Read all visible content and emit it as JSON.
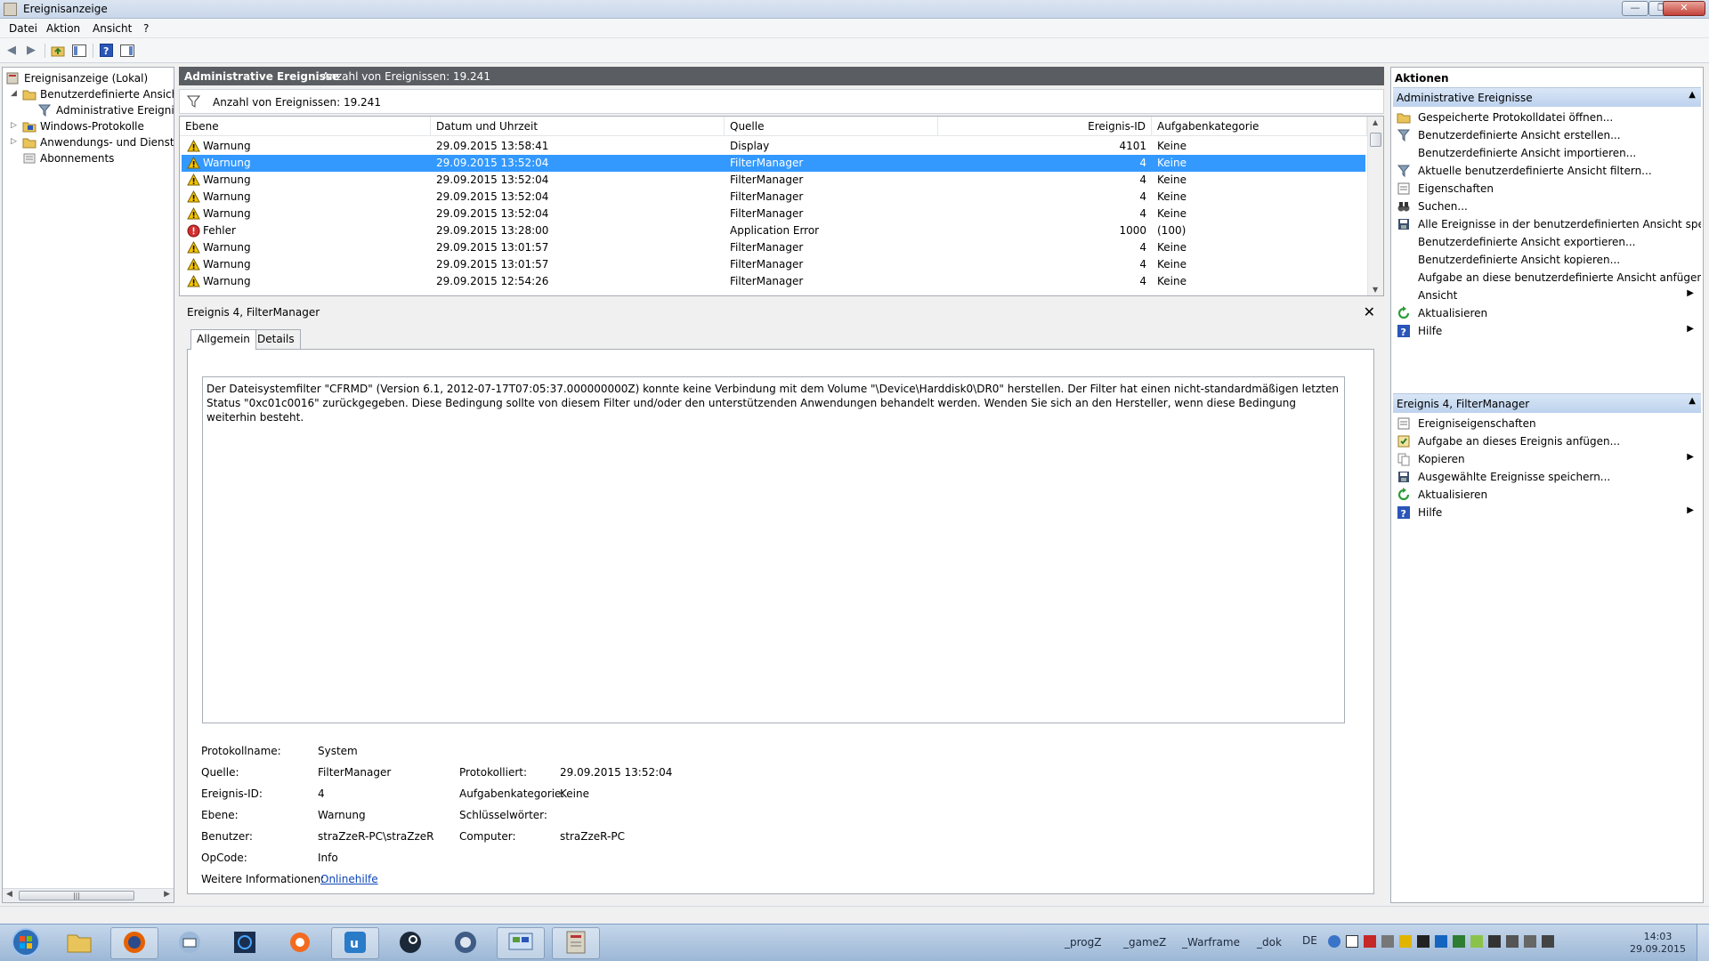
{
  "window": {
    "title": "Ereignisanzeige"
  },
  "menu": [
    "Datei",
    "Aktion",
    "Ansicht",
    "?"
  ],
  "tree": {
    "root": "Ereignisanzeige (Lokal)",
    "custom_views": "Benutzerdefinierte Ansichten",
    "admin_events": "Administrative Ereignisse",
    "windows_logs": "Windows-Protokolle",
    "app_service_logs": "Anwendungs- und Dienstprotokolle",
    "subscriptions": "Abonnements"
  },
  "center": {
    "header_title": "Administrative Ereignisse",
    "header_count": "Anzahl von Ereignissen: 19.241",
    "filter_text": "Anzahl von Ereignissen: 19.241"
  },
  "table": {
    "columns": [
      "Ebene",
      "Datum und Uhrzeit",
      "Quelle",
      "Ereignis-ID",
      "Aufgabenkategorie"
    ],
    "rows": [
      {
        "level": "Warnung",
        "datetime": "29.09.2015 13:58:41",
        "source": "Display",
        "id": "4101",
        "category": "Keine",
        "type": "warn",
        "selected": false
      },
      {
        "level": "Warnung",
        "datetime": "29.09.2015 13:52:04",
        "source": "FilterManager",
        "id": "4",
        "category": "Keine",
        "type": "warn",
        "selected": true
      },
      {
        "level": "Warnung",
        "datetime": "29.09.2015 13:52:04",
        "source": "FilterManager",
        "id": "4",
        "category": "Keine",
        "type": "warn",
        "selected": false
      },
      {
        "level": "Warnung",
        "datetime": "29.09.2015 13:52:04",
        "source": "FilterManager",
        "id": "4",
        "category": "Keine",
        "type": "warn",
        "selected": false
      },
      {
        "level": "Warnung",
        "datetime": "29.09.2015 13:52:04",
        "source": "FilterManager",
        "id": "4",
        "category": "Keine",
        "type": "warn",
        "selected": false
      },
      {
        "level": "Fehler",
        "datetime": "29.09.2015 13:28:00",
        "source": "Application Error",
        "id": "1000",
        "category": "(100)",
        "type": "error",
        "selected": false
      },
      {
        "level": "Warnung",
        "datetime": "29.09.2015 13:01:57",
        "source": "FilterManager",
        "id": "4",
        "category": "Keine",
        "type": "warn",
        "selected": false
      },
      {
        "level": "Warnung",
        "datetime": "29.09.2015 13:01:57",
        "source": "FilterManager",
        "id": "4",
        "category": "Keine",
        "type": "warn",
        "selected": false
      },
      {
        "level": "Warnung",
        "datetime": "29.09.2015 12:54:26",
        "source": "FilterManager",
        "id": "4",
        "category": "Keine",
        "type": "warn",
        "selected": false
      }
    ]
  },
  "details": {
    "title": "Ereignis 4, FilterManager",
    "tab_general": "Allgemein",
    "tab_details": "Details",
    "description": "Der Dateisystemfilter \"CFRMD\" (Version 6.1, 2012-07-17T07:05:37.000000000Z) konnte keine Verbindung mit dem Volume \"\\Device\\Harddisk0\\DR0\" herstellen. Der Filter hat einen nicht-standardmäßigen letzten Status \"0xc01c0016\" zurückgegeben. Diese Bedingung sollte von diesem Filter und/oder den unterstützenden Anwendungen behandelt werden. Wenden Sie sich an den Hersteller, wenn diese Bedingung weiterhin besteht.",
    "labels": {
      "log_name": "Protokollname:",
      "source": "Quelle:",
      "event_id": "Ereignis-ID:",
      "level": "Ebene:",
      "user": "Benutzer:",
      "opcode": "OpCode:",
      "more_info": "Weitere Informationen:",
      "logged": "Protokolliert:",
      "task_category": "Aufgabenkategorie:",
      "keywords": "Schlüsselwörter:",
      "computer": "Computer:"
    },
    "values": {
      "log_name": "System",
      "source": "FilterManager",
      "event_id": "4",
      "level": "Warnung",
      "user": "straZzeR-PC\\straZzeR",
      "opcode": "Info",
      "more_info": "Onlinehilfe",
      "logged": "29.09.2015 13:52:04",
      "task_category": "Keine",
      "keywords": "",
      "computer": "straZzeR-PC"
    }
  },
  "actions": {
    "title": "Aktionen",
    "section1_title": "Administrative Ereignisse",
    "section1": [
      {
        "label": "Gespeicherte Protokolldatei öffnen...",
        "icon": "open-folder-icon",
        "submenu": false
      },
      {
        "label": "Benutzerdefinierte Ansicht erstellen...",
        "icon": "filter-create-icon",
        "submenu": false
      },
      {
        "label": "Benutzerdefinierte Ansicht importieren...",
        "icon": "",
        "submenu": false
      },
      {
        "label": "Aktuelle benutzerdefinierte Ansicht filtern...",
        "icon": "filter-icon",
        "submenu": false
      },
      {
        "label": "Eigenschaften",
        "icon": "properties-icon",
        "submenu": false
      },
      {
        "label": "Suchen...",
        "icon": "binoculars-icon",
        "submenu": false
      },
      {
        "label": "Alle Ereignisse in der benutzerdefinierten Ansicht speic...",
        "icon": "save-icon",
        "submenu": false
      },
      {
        "label": "Benutzerdefinierte Ansicht exportieren...",
        "icon": "",
        "submenu": false
      },
      {
        "label": "Benutzerdefinierte Ansicht kopieren...",
        "icon": "",
        "submenu": false
      },
      {
        "label": "Aufgabe an diese benutzerdefinierte Ansicht anfügen...",
        "icon": "",
        "submenu": false
      },
      {
        "label": "Ansicht",
        "icon": "",
        "submenu": true
      },
      {
        "label": "Aktualisieren",
        "icon": "refresh-icon",
        "submenu": false
      },
      {
        "label": "Hilfe",
        "icon": "help-icon",
        "submenu": true
      }
    ],
    "section2_title": "Ereignis 4, FilterManager",
    "section2": [
      {
        "label": "Ereigniseigenschaften",
        "icon": "properties-icon",
        "submenu": false
      },
      {
        "label": "Aufgabe an dieses Ereignis anfügen...",
        "icon": "task-icon",
        "submenu": false
      },
      {
        "label": "Kopieren",
        "icon": "copy-icon",
        "submenu": true
      },
      {
        "label": "Ausgewählte Ereignisse speichern...",
        "icon": "save-icon",
        "submenu": false
      },
      {
        "label": "Aktualisieren",
        "icon": "refresh-icon",
        "submenu": false
      },
      {
        "label": "Hilfe",
        "icon": "help-icon",
        "submenu": true
      }
    ]
  },
  "taskbar": {
    "apps": [
      "start-orb-icon",
      "explorer-icon",
      "firefox-icon",
      "thunderbird-icon",
      "battlenet-icon",
      "origin-icon",
      "uplay-icon",
      "steam-icon",
      "teamspeak-icon",
      "control-panel-icon",
      "event-viewer-icon"
    ],
    "toolbars": [
      "_progZ",
      "_gameZ",
      "_Warframe",
      "_dok"
    ],
    "lang": "DE",
    "time": "14:03",
    "date": "29.09.2015"
  },
  "colors": {
    "selection": "#3399ff",
    "header_dark": "#5a5d61",
    "section_blue": "#bdd2ee",
    "link": "#0b44b8"
  }
}
